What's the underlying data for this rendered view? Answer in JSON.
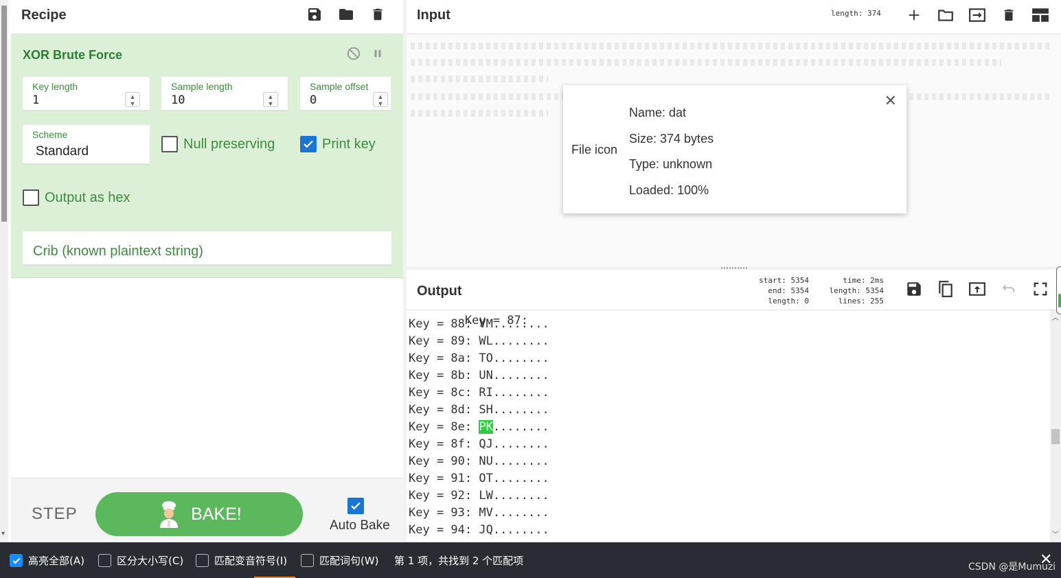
{
  "recipe": {
    "title": "Recipe",
    "operation": {
      "title": "XOR Brute Force",
      "key_length": {
        "label": "Key length",
        "value": "1"
      },
      "sample_length": {
        "label": "Sample length",
        "value": "10"
      },
      "sample_offset": {
        "label": "Sample offset",
        "value": "0"
      },
      "scheme": {
        "label": "Scheme",
        "value": "Standard"
      },
      "null_preserving": {
        "label": "Null preserving",
        "checked": false
      },
      "print_key": {
        "label": "Print key",
        "checked": true
      },
      "output_as_hex": {
        "label": "Output as hex",
        "checked": false
      },
      "crib": {
        "placeholder": "Crib (known plaintext string)"
      }
    },
    "step_label": "STEP",
    "bake_label": "BAKE!",
    "auto_bake": {
      "label": "Auto Bake",
      "checked": true
    }
  },
  "input": {
    "title": "Input",
    "stats": "length: 374",
    "file": {
      "icon_label": "File icon",
      "name": "Name: dat",
      "size": "Size: 374 bytes",
      "type": "Type: unknown",
      "loaded": "Loaded: 100%"
    }
  },
  "output": {
    "title": "Output",
    "stats_left": [
      "start: 5354",
      "end: 5354",
      "length:    0"
    ],
    "stats_right": [
      "time:   2ms",
      "length: 5354",
      "lines:  255"
    ],
    "lines": [
      {
        "prefix": "Key = 88: ",
        "hl": "",
        "rest": "VM........"
      },
      {
        "prefix": "Key = 89: ",
        "hl": "",
        "rest": "WL........"
      },
      {
        "prefix": "Key = 8a: ",
        "hl": "",
        "rest": "TO........"
      },
      {
        "prefix": "Key = 8b: ",
        "hl": "",
        "rest": "UN........"
      },
      {
        "prefix": "Key = 8c: ",
        "hl": "",
        "rest": "RI........"
      },
      {
        "prefix": "Key = 8d: ",
        "hl": "",
        "rest": "SH........"
      },
      {
        "prefix": "Key = 8e: ",
        "hl": "PK",
        "rest": "........"
      },
      {
        "prefix": "Key = 8f: ",
        "hl": "",
        "rest": "QJ........"
      },
      {
        "prefix": "Key = 90: ",
        "hl": "",
        "rest": "NU........"
      },
      {
        "prefix": "Key = 91: ",
        "hl": "",
        "rest": "OT........"
      },
      {
        "prefix": "Key = 92: ",
        "hl": "",
        "rest": "LW........"
      },
      {
        "prefix": "Key = 93: ",
        "hl": "",
        "rest": "MV........"
      },
      {
        "prefix": "Key = 94: ",
        "hl": "",
        "rest": "JQ........"
      }
    ]
  },
  "findbar": {
    "highlight_all": {
      "label": "高亮全部(A)",
      "checked": true
    },
    "match_case": {
      "label": "区分大小写(C)",
      "checked": false
    },
    "match_diacritics": {
      "label": "匹配变音符号(I)",
      "checked": false
    },
    "whole_words": {
      "label": "匹配词句(W)",
      "checked": false
    },
    "status": "第 1 项，共找到 2 个匹配项"
  },
  "watermark": "CSDN @是Mumuzi"
}
